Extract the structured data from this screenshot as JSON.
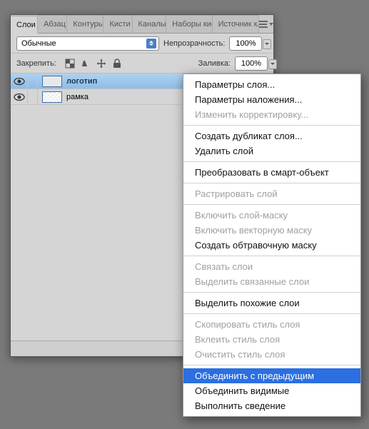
{
  "tabs": [
    "Слои",
    "Абзац",
    "Контуры",
    "Кисти",
    "Каналы",
    "Наборы кис",
    "Источник кл"
  ],
  "active_tab_index": 0,
  "blend_mode": "Обычные",
  "opacity_label": "Непрозрачность:",
  "opacity_value": "100%",
  "lock_label": "Закрепить:",
  "fill_label": "Заливка:",
  "fill_value": "100%",
  "layers": [
    {
      "name": "логотип",
      "selected": true
    },
    {
      "name": "рамка",
      "selected": false
    }
  ],
  "menu": [
    {
      "t": "Параметры слоя...",
      "state": "enabled"
    },
    {
      "t": "Параметры наложения...",
      "state": "enabled"
    },
    {
      "t": "Изменить корректировку...",
      "state": "disabled"
    },
    {
      "sep": true
    },
    {
      "t": "Создать дубликат слоя...",
      "state": "enabled"
    },
    {
      "t": "Удалить слой",
      "state": "enabled"
    },
    {
      "sep": true
    },
    {
      "t": "Преобразовать в смарт-объект",
      "state": "enabled"
    },
    {
      "sep": true
    },
    {
      "t": "Растрировать слой",
      "state": "disabled"
    },
    {
      "sep": true
    },
    {
      "t": "Включить слой-маску",
      "state": "disabled"
    },
    {
      "t": "Включить векторную маску",
      "state": "disabled"
    },
    {
      "t": "Создать обтравочную маску",
      "state": "enabled"
    },
    {
      "sep": true
    },
    {
      "t": "Связать слои",
      "state": "disabled"
    },
    {
      "t": "Выделить связанные слои",
      "state": "disabled"
    },
    {
      "sep": true
    },
    {
      "t": "Выделить похожие слои",
      "state": "enabled"
    },
    {
      "sep": true
    },
    {
      "t": "Скопировать стиль слоя",
      "state": "disabled"
    },
    {
      "t": "Вклеить стиль слоя",
      "state": "disabled"
    },
    {
      "t": "Очистить стиль слоя",
      "state": "disabled"
    },
    {
      "sep": true
    },
    {
      "t": "Объединить с предыдущим",
      "state": "highlight"
    },
    {
      "t": "Объединить видимые",
      "state": "enabled"
    },
    {
      "t": "Выполнить сведение",
      "state": "enabled"
    }
  ]
}
